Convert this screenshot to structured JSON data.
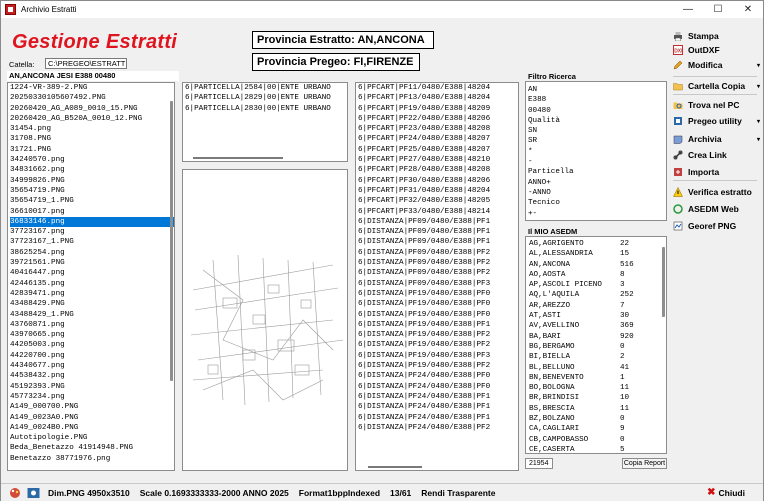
{
  "window": {
    "title": "Archivio Estratti",
    "min": "—",
    "max": "☐",
    "close": "✕"
  },
  "brand": {
    "title": "Gestione Estratti"
  },
  "catella": {
    "label": "Catella:",
    "path": "C:\\PREGEO\\ESTRATTI"
  },
  "selection_header": "AN,ANCONA  JESI  E388  00480",
  "province_estratto": "Provincia Estratto: AN,ANCONA",
  "province_pregeo": "Provincia Pregeo: FI,FIRENZE",
  "files": [
    "1224-VR-389-2.PNG",
    "20250330105607492.PNG",
    "20260420_AG_A089_0010_15.PNG",
    "20260420_AG_B520A_0010_12.PNG",
    "31454.png",
    "31708.PNG",
    "31721.PNG",
    "34240570.png",
    "34831662.png",
    "34999826.PNG",
    "35654719.PNG",
    "35654719_1.PNG",
    "36610017.png",
    "36833146.png",
    "37723167.png",
    "37723167_1.PNG",
    "38625254.png",
    "39721561.PNG",
    "40416447.png",
    "42446135.png",
    "42839471.png",
    "43488429.PNG",
    "43488429_1.PNG",
    "43760871.png",
    "43970665.png",
    "44205003.png",
    "44220700.png",
    "44340677.png",
    "44538432.png",
    "45192393.PNG",
    "45773234.png",
    "A149_000700.PNG",
    "A149_0023A0.PNG",
    "A149_0024B0.PNG",
    "Autotipologie.PNG",
    "Beda_Benetazzo 41914948.PNG",
    "Benetazzo 38771976.png"
  ],
  "selected_file_index": 13,
  "particelle": [
    "6|PARTICELLA|2584|00|ENTE URBANO",
    "6|PARTICELLA|2829|00|ENTE URBANO",
    "6|PARTICELLA|2830|00|ENTE URBANO"
  ],
  "records": [
    "6|PFCART|PF11/0480/E388|48204",
    "6|PFCART|PF13/0480/E388|48204",
    "6|PFCART|PF19/0480/E388|48209",
    "6|PFCART|PF22/0480/E388|48206",
    "6|PFCART|PF23/0480/E388|48208",
    "6|PFCART|PF24/0480/E388|48207",
    "6|PFCART|PF25/0480/E388|48207",
    "6|PFCART|PF27/0480/E388|48210",
    "6|PFCART|PF28/0480/E388|48208",
    "6|PFCART|PF30/0480/E388|48206",
    "6|PFCART|PF31/0480/E388|48204",
    "6|PFCART|PF32/0480/E388|48205",
    "6|PFCART|PF33/0480/E388|48214",
    "6|DISTANZA|PF09/0480/E388|PF1",
    "6|DISTANZA|PF09/0480/E388|PF1",
    "6|DISTANZA|PF09/0480/E388|PF1",
    "6|DISTANZA|PF09/0480/E388|PF2",
    "6|DISTANZA|PF09/0480/E388|PF2",
    "6|DISTANZA|PF09/0480/E388|PF2",
    "6|DISTANZA|PF09/0480/E388|PF3",
    "6|DISTANZA|PF19/0480/E388|PF0",
    "6|DISTANZA|PF19/0480/E388|PF0",
    "6|DISTANZA|PF19/0480/E388|PF0",
    "6|DISTANZA|PF19/0480/E388|PF1",
    "6|DISTANZA|PF19/0480/E388|PF2",
    "6|DISTANZA|PF19/0480/E388|PF2",
    "6|DISTANZA|PF19/0480/E388|PF3",
    "6|DISTANZA|PF19/0480/E388|PF2",
    "6|DISTANZA|PF24/0480/E388|PF0",
    "6|DISTANZA|PF24/0480/E388|PF0",
    "6|DISTANZA|PF24/0480/E388|PF1",
    "6|DISTANZA|PF24/0480/E388|PF1",
    "6|DISTANZA|PF24/0480/E388|PF1",
    "6|DISTANZA|PF24/0480/E388|PF2"
  ],
  "filtro": {
    "title": "Filtro Ricerca",
    "items": [
      "AN",
      "E388",
      "00480",
      "Qualità",
      "SN",
      "SR",
      "*",
      "-",
      "Particella",
      "ANNO+",
      "-ANNO",
      "Tecnico",
      "+-"
    ]
  },
  "asedm": {
    "title": "Il MIO ASEDM",
    "rows": [
      [
        "AG,AGRIGENTO",
        "22"
      ],
      [
        "AL,ALESSANDRIA",
        "15"
      ],
      [
        "AN,ANCONA",
        "516"
      ],
      [
        "AO,AOSTA",
        "8"
      ],
      [
        "AP,ASCOLI PICENO",
        "3"
      ],
      [
        "AQ,L'AQUILA",
        "252"
      ],
      [
        "AR,AREZZO",
        "7"
      ],
      [
        "AT,ASTI",
        "30"
      ],
      [
        "AV,AVELLINO",
        "369"
      ],
      [
        "BA,BARI",
        "920"
      ],
      [
        "BG,BERGAMO",
        "0"
      ],
      [
        "BI,BIELLA",
        "2"
      ],
      [
        "BL,BELLUNO",
        "41"
      ],
      [
        "BN,BENEVENTO",
        "1"
      ],
      [
        "BO,BOLOGNA",
        "11"
      ],
      [
        "BR,BRINDISI",
        "10"
      ],
      [
        "BS,BRESCIA",
        "11"
      ],
      [
        "BZ,BOLZANO",
        "0"
      ],
      [
        "CA,CAGLIARI",
        "9"
      ],
      [
        "CB,CAMPOBASSO",
        "0"
      ],
      [
        "CE,CASERTA",
        "5"
      ]
    ],
    "total": "21954",
    "copy_label": "Copia Report"
  },
  "side_menu": [
    {
      "label": "Stampa",
      "icon": "printer-icon",
      "arrow": false
    },
    {
      "label": "OutDXF",
      "icon": "dxf-icon",
      "arrow": false
    },
    {
      "label": "Modifica",
      "icon": "edit-icon",
      "arrow": true
    },
    {
      "label": "Cartella Copia",
      "icon": "folder-icon",
      "arrow": true
    },
    {
      "label": "Trova nel PC",
      "icon": "search-folder-icon",
      "arrow": false
    },
    {
      "label": "Pregeo utility",
      "icon": "utility-icon",
      "arrow": true
    },
    {
      "label": "Archivia",
      "icon": "archive-icon",
      "arrow": true
    },
    {
      "label": "Crea Link",
      "icon": "link-icon",
      "arrow": false
    },
    {
      "label": "Importa",
      "icon": "import-icon",
      "arrow": false
    },
    {
      "label": "Verifica estratto",
      "icon": "warning-icon",
      "arrow": false
    },
    {
      "label": "ASEDM Web",
      "icon": "recycle-icon",
      "arrow": false
    },
    {
      "label": "Georef PNG",
      "icon": "georef-icon",
      "arrow": false
    }
  ],
  "status": {
    "dim": "Dim.PNG 4950x3510",
    "scale": "Scale 0.1693333333-2000 ANNO 2025",
    "format": "Format1bppIndexed",
    "page": "13/61",
    "transparent": "Rendi Trasparente",
    "close": "Chiudi"
  },
  "colors": {
    "brand": "#e0141e",
    "selection": "#0078d7"
  }
}
